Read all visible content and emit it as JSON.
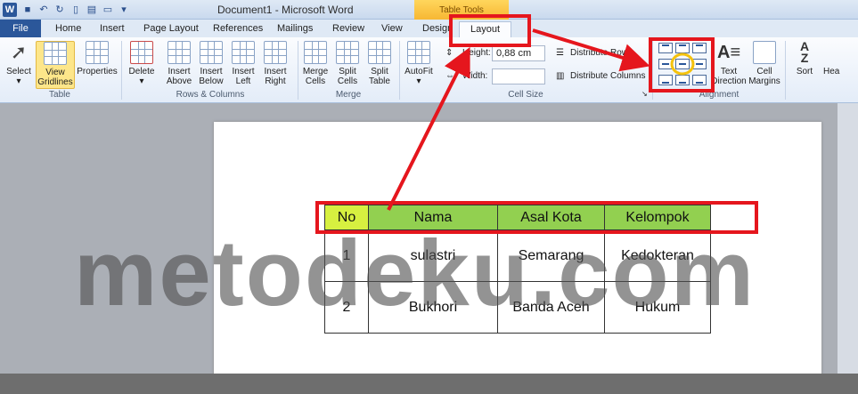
{
  "titlebar": {
    "app_title": "Document1 - Microsoft Word",
    "contextual_tab": "Table Tools"
  },
  "tabs": [
    "File",
    "Home",
    "Insert",
    "Page Layout",
    "References",
    "Mailings",
    "Review",
    "View",
    "Design",
    "Layout"
  ],
  "ribbon": {
    "table_group": {
      "label": "Table",
      "select": "Select",
      "view_gridlines_1": "View",
      "view_gridlines_2": "Gridlines",
      "properties": "Properties"
    },
    "rows_columns_group": {
      "label": "Rows & Columns",
      "delete": "Delete",
      "insert_above_1": "Insert",
      "insert_above_2": "Above",
      "insert_below_1": "Insert",
      "insert_below_2": "Below",
      "insert_left_1": "Insert",
      "insert_left_2": "Left",
      "insert_right_1": "Insert",
      "insert_right_2": "Right"
    },
    "merge_group": {
      "label": "Merge",
      "merge_cells_1": "Merge",
      "merge_cells_2": "Cells",
      "split_cells_1": "Split",
      "split_cells_2": "Cells",
      "split_table_1": "Split",
      "split_table_2": "Table"
    },
    "cell_size_group": {
      "label": "Cell Size",
      "autofit": "AutoFit",
      "height_label": "Height:",
      "height_value": "0,88 cm",
      "width_label": "Width:",
      "distribute_rows": "Distribute Rows",
      "distribute_columns": "Distribute Columns"
    },
    "alignment_group": {
      "label": "Alignment",
      "text_direction_1": "Text",
      "text_direction_2": "Direction",
      "cell_margins_1": "Cell",
      "cell_margins_2": "Margins"
    },
    "data_group": {
      "sort": "Sort",
      "repeat_header": "Hea"
    }
  },
  "table": {
    "headers": [
      "No",
      "Nama",
      "Asal Kota",
      "Kelompok"
    ],
    "rows": [
      [
        "1",
        "sulastri",
        "Semarang",
        "Kedokteran"
      ],
      [
        "2",
        "Bukhori",
        "Banda Aceh",
        "Hukum"
      ]
    ]
  },
  "watermark": "metodeku.com",
  "colors": {
    "annotation": "#e5161d",
    "header_fill": "#92d050",
    "accent": "#2b579a"
  }
}
